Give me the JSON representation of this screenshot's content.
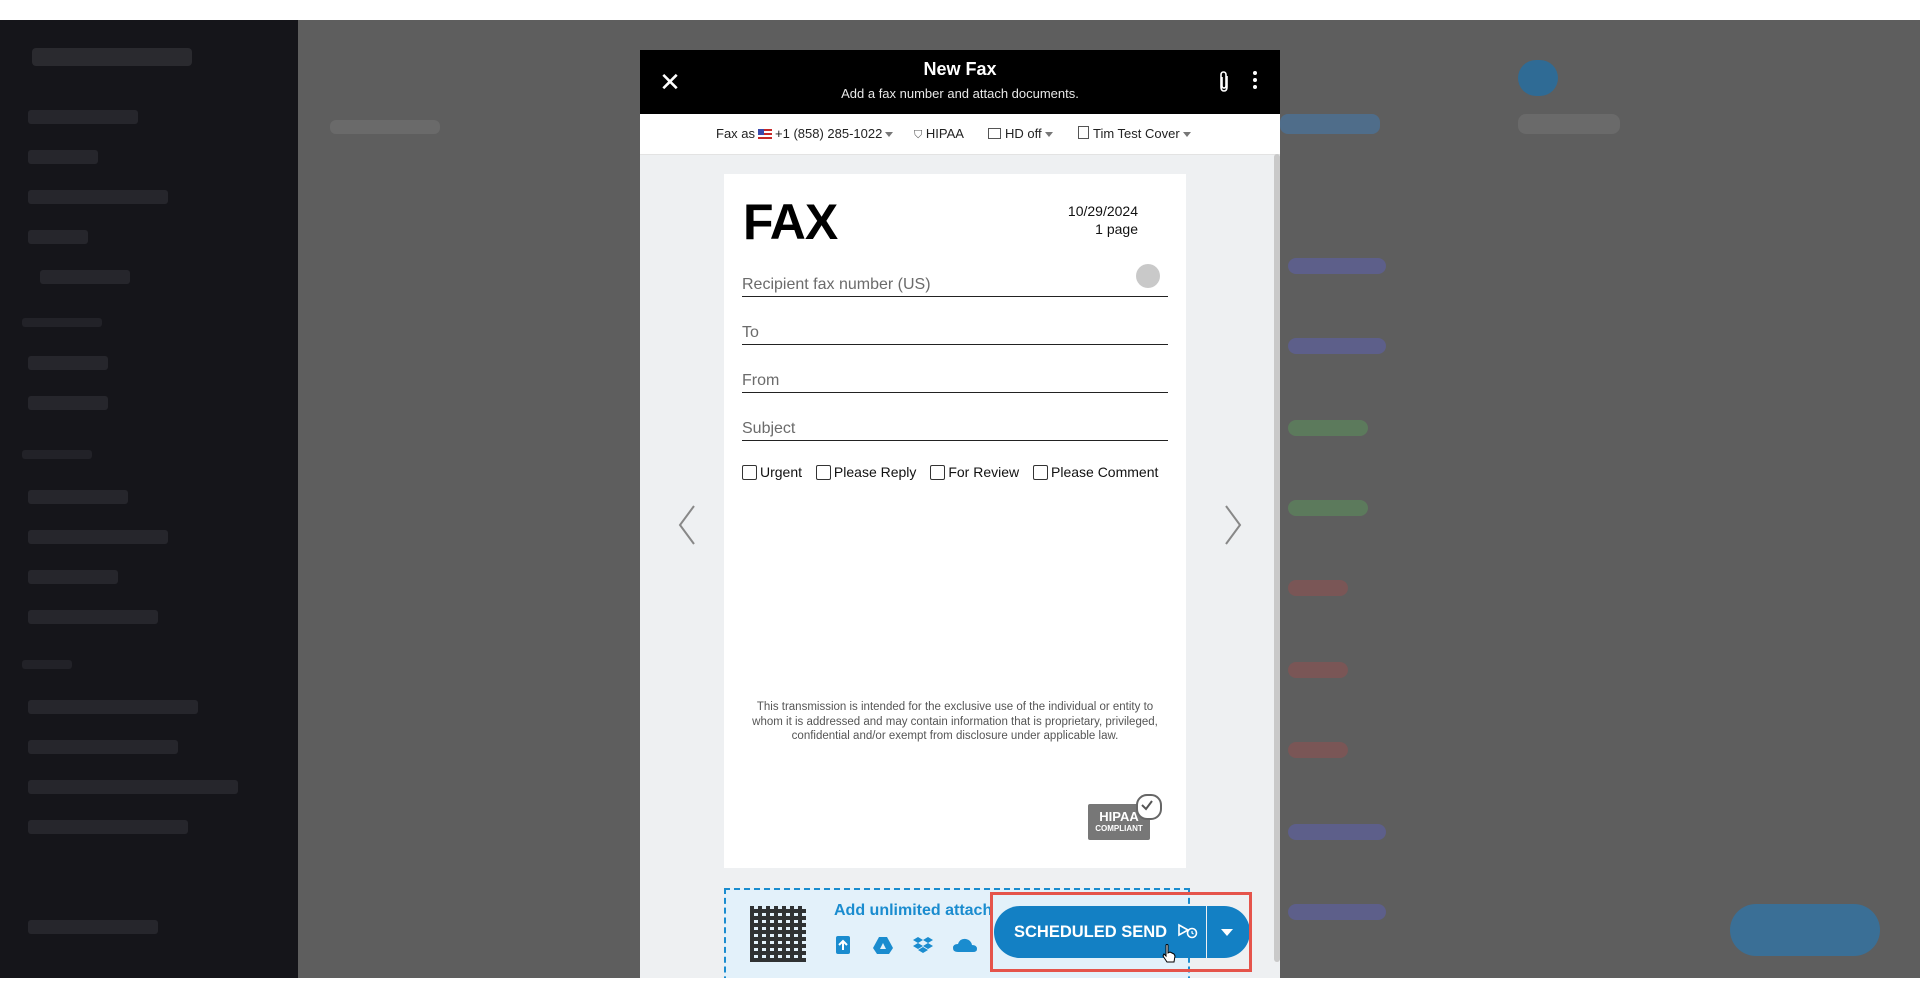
{
  "modal": {
    "title": "New Fax",
    "subtitle": "Add a fax number and attach documents."
  },
  "toolbar": {
    "fax_as_label": "Fax as",
    "fax_as_number": "+1 (858) 285-1022",
    "hipaa_label": "HIPAA",
    "hd_label": "HD off",
    "cover_label": "Tim Test Cover"
  },
  "cover": {
    "logo": "FAX",
    "date": "10/29/2024",
    "pages": "1 page",
    "recipient_placeholder": "Recipient fax number (US)",
    "to_placeholder": "To",
    "from_placeholder": "From",
    "subject_placeholder": "Subject",
    "checkboxes": [
      "Urgent",
      "Please Reply",
      "For Review",
      "Please Comment"
    ],
    "disclaimer": "This transmission is intended for the exclusive use of the individual or entity to whom it is addressed and may contain information that is proprietary, privileged, confidential and/or exempt from disclosure under applicable law.",
    "badge_line1": "HIPAA",
    "badge_line2": "COMPLIANT"
  },
  "attachments": {
    "label": "Add unlimited attach",
    "sources": [
      "upload-icon",
      "google-drive-icon",
      "dropbox-icon",
      "onedrive-icon"
    ]
  },
  "send": {
    "label": "SCHEDULED SEND"
  },
  "colors": {
    "accent": "#1380c4",
    "highlight": "#e5544b",
    "header": "#000000"
  }
}
